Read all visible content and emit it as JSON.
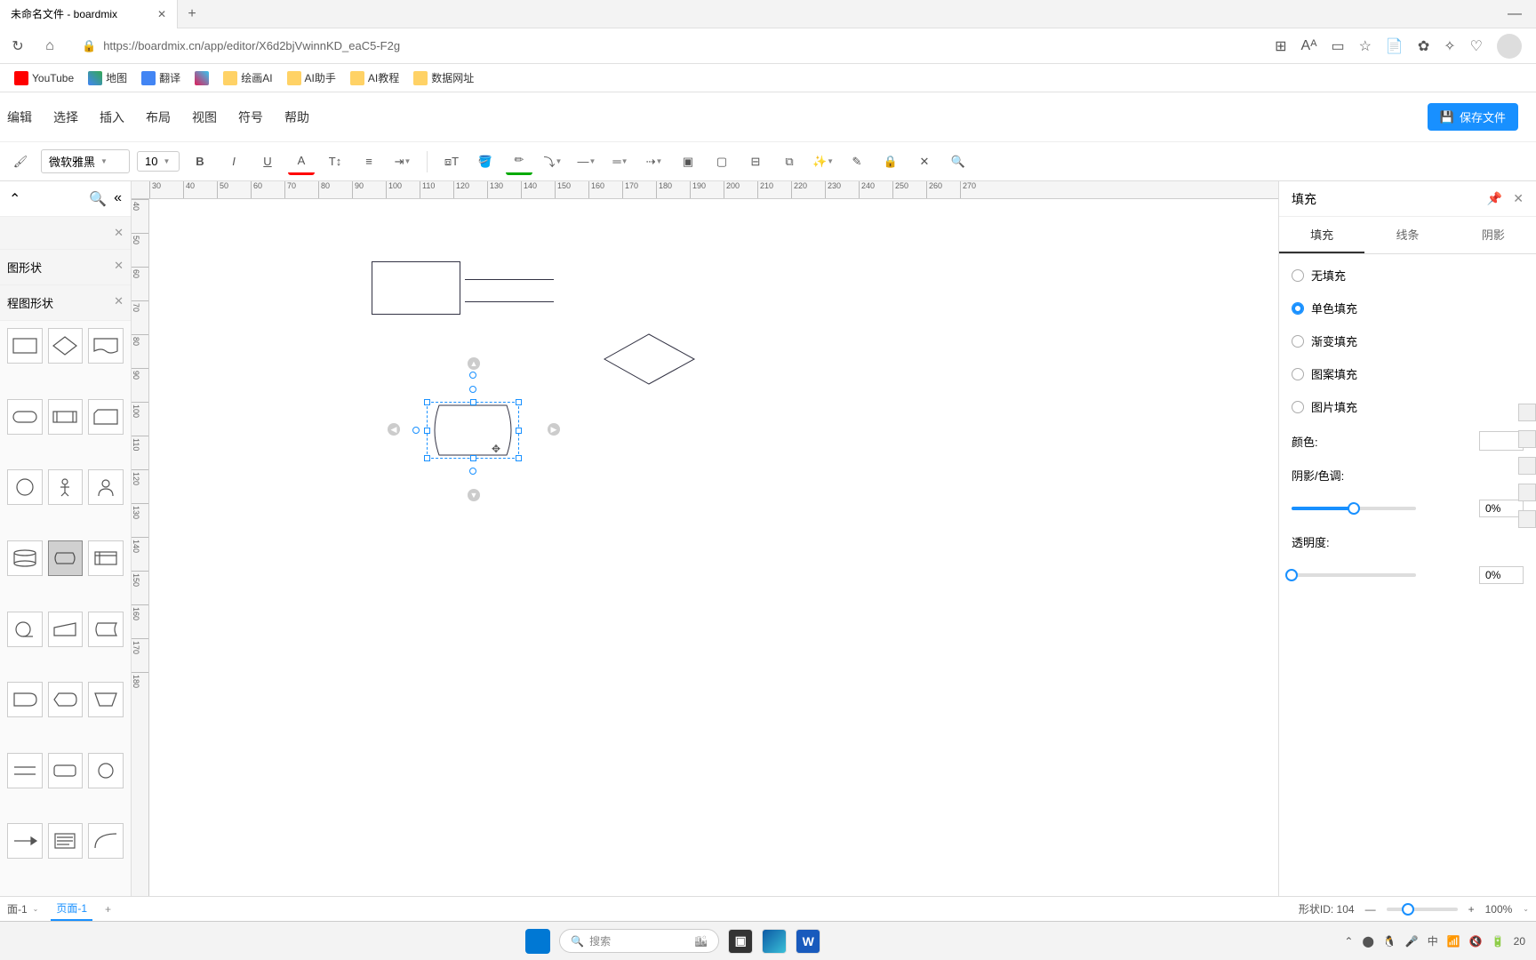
{
  "browser": {
    "tab_title": "未命名文件 - boardmix",
    "url": "https://boardmix.cn/app/editor/X6d2bjVwinnKD_eaC5-F2g"
  },
  "bookmarks": [
    {
      "label": "YouTube",
      "ico": "yt"
    },
    {
      "label": "地图",
      "ico": "gmap"
    },
    {
      "label": "翻译",
      "ico": "gt"
    },
    {
      "label": "",
      "ico": "slack"
    },
    {
      "label": "绘画AI",
      "ico": "folder"
    },
    {
      "label": "AI助手",
      "ico": "folder"
    },
    {
      "label": "AI教程",
      "ico": "folder"
    },
    {
      "label": "数据网址",
      "ico": "folder"
    }
  ],
  "menu": [
    "编辑",
    "选择",
    "插入",
    "布局",
    "视图",
    "符号",
    "帮助"
  ],
  "save_btn": "保存文件",
  "toolbar": {
    "font": "微软雅黑",
    "size": "10"
  },
  "ruler_h": [
    "30",
    "40",
    "50",
    "60",
    "70",
    "80",
    "90",
    "100",
    "110",
    "120",
    "130",
    "140",
    "150",
    "160",
    "170",
    "180",
    "190",
    "200",
    "210",
    "220",
    "230",
    "240",
    "250",
    "260",
    "270"
  ],
  "ruler_v": [
    "40",
    "50",
    "60",
    "70",
    "80",
    "90",
    "100",
    "110",
    "120",
    "130",
    "140",
    "150",
    "160",
    "170",
    "180"
  ],
  "sidebar": {
    "cat1": "图形状",
    "cat2": "程图形状"
  },
  "panel": {
    "title": "填充",
    "tabs": [
      "填充",
      "线条",
      "阴影"
    ],
    "fill_opts": [
      "无填充",
      "单色填充",
      "渐变填充",
      "图案填充",
      "图片填充"
    ],
    "selected_fill": 1,
    "color_label": "颜色:",
    "shade_label": "阴影/色调:",
    "shade_val": "0%",
    "opacity_label": "透明度:",
    "opacity_val": "0%"
  },
  "pagetabs": {
    "dd": "面-1",
    "tab": "页面-1"
  },
  "status": {
    "shape_id": "形状ID: 104",
    "zoom": "100%"
  },
  "taskbar": {
    "search": "搜索",
    "time": "20"
  }
}
